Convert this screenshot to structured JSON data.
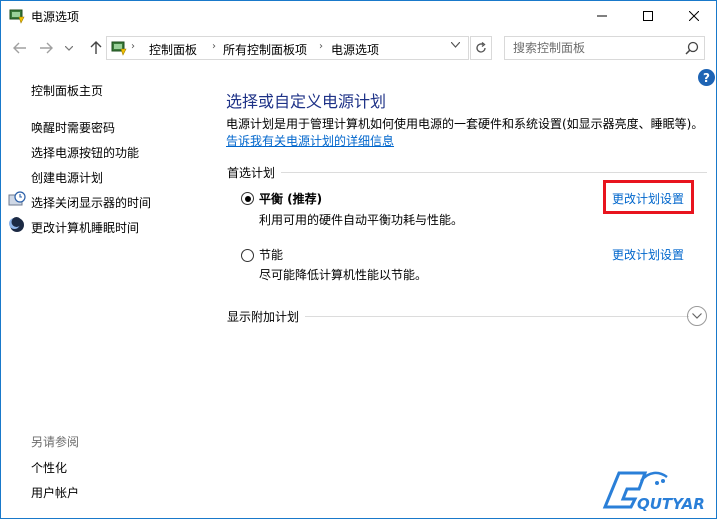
{
  "window": {
    "title": "电源选项"
  },
  "address_bar": {
    "crumbs": [
      "控制面板",
      "所有控制面板项",
      "电源选项"
    ],
    "search_placeholder": "搜索控制面板"
  },
  "sidebar": {
    "home_link": "控制面板主页",
    "links": [
      "唤醒时需要密码",
      "选择电源按钮的功能",
      "创建电源计划",
      "选择关闭显示器的时间",
      "更改计算机睡眠时间"
    ],
    "see_also_title": "另请参阅",
    "see_also_links": [
      "个性化",
      "用户帐户"
    ]
  },
  "main": {
    "title": "选择或自定义电源计划",
    "description": "电源计划是用于管理计算机如何使用电源的一套硬件和系统设置(如显示器亮度、睡眠等)。",
    "more_info_link": "告诉我有关电源计划的详细信息",
    "preferred_plans_label": "首选计划",
    "plans": [
      {
        "name": "平衡 (推荐)",
        "description": "利用可用的硬件自动平衡功耗与性能。",
        "selected": true,
        "change_link": "更改计划设置"
      },
      {
        "name": "节能",
        "description": "尽可能降低计算机性能以节能。",
        "selected": false,
        "change_link": "更改计划设置"
      }
    ],
    "show_additional_label": "显示附加计划"
  },
  "watermark": {
    "text": "QUTYAR"
  },
  "colors": {
    "accent": "#1979ca",
    "link": "#0066cc",
    "title": "#1e3287",
    "highlight": "#e8141e"
  },
  "icons": [
    "app-icon",
    "back-arrow-icon",
    "forward-arrow-icon",
    "up-arrow-icon",
    "refresh-icon",
    "search-icon",
    "help-icon",
    "clock-icon",
    "moon-icon",
    "chevron-down-icon"
  ]
}
